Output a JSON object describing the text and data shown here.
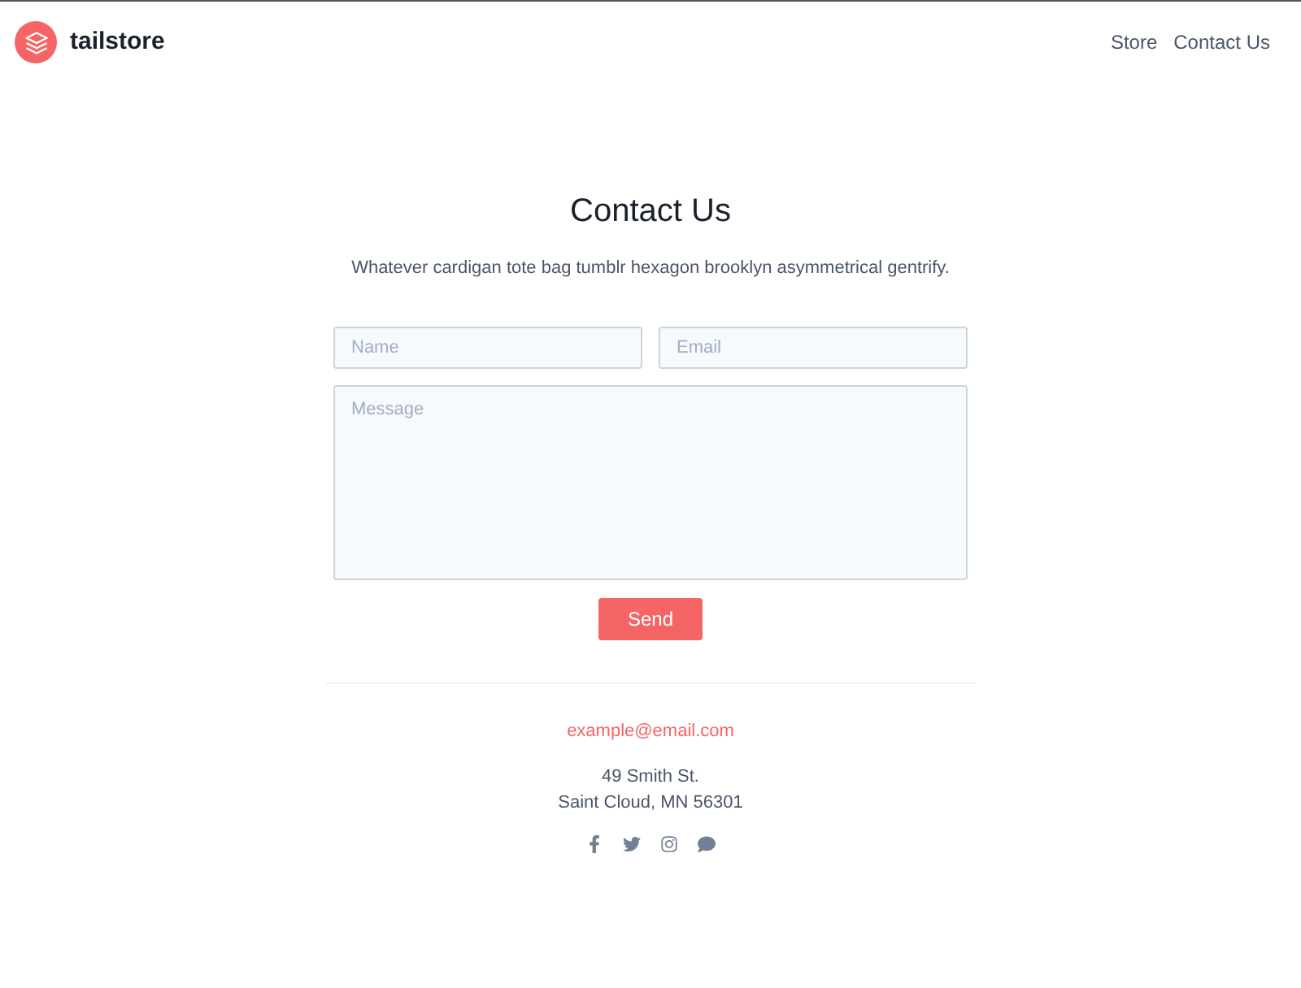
{
  "header": {
    "brand": "tailstore",
    "nav": [
      {
        "label": "Store"
      },
      {
        "label": "Contact Us"
      }
    ]
  },
  "contact": {
    "title": "Contact Us",
    "subtitle": "Whatever cardigan tote bag tumblr hexagon brooklyn asymmetrical gentrify.",
    "fields": [
      {
        "placeholder": "Name"
      },
      {
        "placeholder": "Email"
      }
    ],
    "message": {
      "placeholder": "Message"
    },
    "button": "Send"
  },
  "footer": {
    "email": "example@email.com",
    "address": [
      "49 Smith St.",
      "Saint Cloud, MN 56301"
    ]
  }
}
